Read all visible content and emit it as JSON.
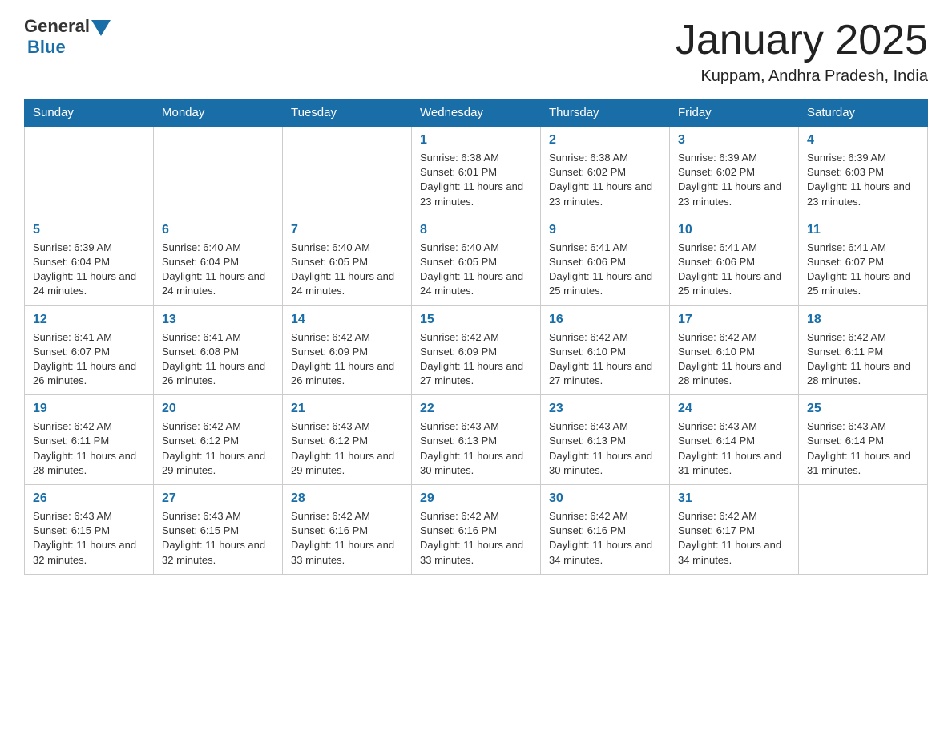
{
  "header": {
    "logo_general": "General",
    "logo_blue": "Blue",
    "month_title": "January 2025",
    "location": "Kuppam, Andhra Pradesh, India"
  },
  "weekdays": [
    "Sunday",
    "Monday",
    "Tuesday",
    "Wednesday",
    "Thursday",
    "Friday",
    "Saturday"
  ],
  "weeks": [
    [
      {
        "day": "",
        "info": ""
      },
      {
        "day": "",
        "info": ""
      },
      {
        "day": "",
        "info": ""
      },
      {
        "day": "1",
        "info": "Sunrise: 6:38 AM\nSunset: 6:01 PM\nDaylight: 11 hours and 23 minutes."
      },
      {
        "day": "2",
        "info": "Sunrise: 6:38 AM\nSunset: 6:02 PM\nDaylight: 11 hours and 23 minutes."
      },
      {
        "day": "3",
        "info": "Sunrise: 6:39 AM\nSunset: 6:02 PM\nDaylight: 11 hours and 23 minutes."
      },
      {
        "day": "4",
        "info": "Sunrise: 6:39 AM\nSunset: 6:03 PM\nDaylight: 11 hours and 23 minutes."
      }
    ],
    [
      {
        "day": "5",
        "info": "Sunrise: 6:39 AM\nSunset: 6:04 PM\nDaylight: 11 hours and 24 minutes."
      },
      {
        "day": "6",
        "info": "Sunrise: 6:40 AM\nSunset: 6:04 PM\nDaylight: 11 hours and 24 minutes."
      },
      {
        "day": "7",
        "info": "Sunrise: 6:40 AM\nSunset: 6:05 PM\nDaylight: 11 hours and 24 minutes."
      },
      {
        "day": "8",
        "info": "Sunrise: 6:40 AM\nSunset: 6:05 PM\nDaylight: 11 hours and 24 minutes."
      },
      {
        "day": "9",
        "info": "Sunrise: 6:41 AM\nSunset: 6:06 PM\nDaylight: 11 hours and 25 minutes."
      },
      {
        "day": "10",
        "info": "Sunrise: 6:41 AM\nSunset: 6:06 PM\nDaylight: 11 hours and 25 minutes."
      },
      {
        "day": "11",
        "info": "Sunrise: 6:41 AM\nSunset: 6:07 PM\nDaylight: 11 hours and 25 minutes."
      }
    ],
    [
      {
        "day": "12",
        "info": "Sunrise: 6:41 AM\nSunset: 6:07 PM\nDaylight: 11 hours and 26 minutes."
      },
      {
        "day": "13",
        "info": "Sunrise: 6:41 AM\nSunset: 6:08 PM\nDaylight: 11 hours and 26 minutes."
      },
      {
        "day": "14",
        "info": "Sunrise: 6:42 AM\nSunset: 6:09 PM\nDaylight: 11 hours and 26 minutes."
      },
      {
        "day": "15",
        "info": "Sunrise: 6:42 AM\nSunset: 6:09 PM\nDaylight: 11 hours and 27 minutes."
      },
      {
        "day": "16",
        "info": "Sunrise: 6:42 AM\nSunset: 6:10 PM\nDaylight: 11 hours and 27 minutes."
      },
      {
        "day": "17",
        "info": "Sunrise: 6:42 AM\nSunset: 6:10 PM\nDaylight: 11 hours and 28 minutes."
      },
      {
        "day": "18",
        "info": "Sunrise: 6:42 AM\nSunset: 6:11 PM\nDaylight: 11 hours and 28 minutes."
      }
    ],
    [
      {
        "day": "19",
        "info": "Sunrise: 6:42 AM\nSunset: 6:11 PM\nDaylight: 11 hours and 28 minutes."
      },
      {
        "day": "20",
        "info": "Sunrise: 6:42 AM\nSunset: 6:12 PM\nDaylight: 11 hours and 29 minutes."
      },
      {
        "day": "21",
        "info": "Sunrise: 6:43 AM\nSunset: 6:12 PM\nDaylight: 11 hours and 29 minutes."
      },
      {
        "day": "22",
        "info": "Sunrise: 6:43 AM\nSunset: 6:13 PM\nDaylight: 11 hours and 30 minutes."
      },
      {
        "day": "23",
        "info": "Sunrise: 6:43 AM\nSunset: 6:13 PM\nDaylight: 11 hours and 30 minutes."
      },
      {
        "day": "24",
        "info": "Sunrise: 6:43 AM\nSunset: 6:14 PM\nDaylight: 11 hours and 31 minutes."
      },
      {
        "day": "25",
        "info": "Sunrise: 6:43 AM\nSunset: 6:14 PM\nDaylight: 11 hours and 31 minutes."
      }
    ],
    [
      {
        "day": "26",
        "info": "Sunrise: 6:43 AM\nSunset: 6:15 PM\nDaylight: 11 hours and 32 minutes."
      },
      {
        "day": "27",
        "info": "Sunrise: 6:43 AM\nSunset: 6:15 PM\nDaylight: 11 hours and 32 minutes."
      },
      {
        "day": "28",
        "info": "Sunrise: 6:42 AM\nSunset: 6:16 PM\nDaylight: 11 hours and 33 minutes."
      },
      {
        "day": "29",
        "info": "Sunrise: 6:42 AM\nSunset: 6:16 PM\nDaylight: 11 hours and 33 minutes."
      },
      {
        "day": "30",
        "info": "Sunrise: 6:42 AM\nSunset: 6:16 PM\nDaylight: 11 hours and 34 minutes."
      },
      {
        "day": "31",
        "info": "Sunrise: 6:42 AM\nSunset: 6:17 PM\nDaylight: 11 hours and 34 minutes."
      },
      {
        "day": "",
        "info": ""
      }
    ]
  ]
}
